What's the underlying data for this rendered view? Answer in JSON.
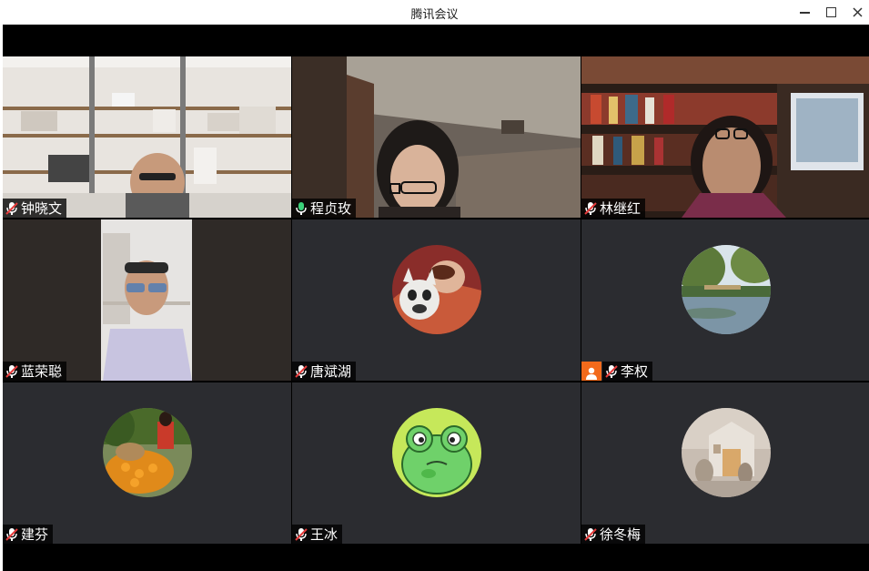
{
  "window": {
    "title": "腾讯会议",
    "controls": [
      "minimize",
      "maximize",
      "close"
    ]
  },
  "participants": [
    {
      "name": "钟晓文",
      "mic": "muted",
      "video": "on",
      "background": "bookshelf-office"
    },
    {
      "name": "程贞玫",
      "mic": "active",
      "video": "on",
      "active_speaker": true,
      "background": "room-ceiling"
    },
    {
      "name": "林继红",
      "mic": "muted",
      "video": "on",
      "background": "library-bookshelf"
    },
    {
      "name": "蓝荣聪",
      "mic": "muted",
      "video": "on",
      "background": "portrait-room"
    },
    {
      "name": "唐斌湖",
      "mic": "muted",
      "video": "off",
      "avatar": "bulldog-and-child"
    },
    {
      "name": "李权",
      "mic": "muted",
      "video": "off",
      "avatar": "lake-scenery",
      "host_badge": true
    },
    {
      "name": "建芬",
      "mic": "muted",
      "video": "off",
      "avatar": "woman-with-flowers"
    },
    {
      "name": "王冰",
      "mic": "muted",
      "video": "off",
      "avatar": "cartoon-frog"
    },
    {
      "name": "徐冬梅",
      "mic": "muted",
      "video": "off",
      "avatar": "miniature-scene"
    }
  ],
  "colors": {
    "tile_bg": "#2b2c30",
    "active_border": "#3bd17a",
    "muted_mic": "#e43b3b",
    "active_mic": "#3bd17a",
    "host_badge": "#f26a1b"
  }
}
